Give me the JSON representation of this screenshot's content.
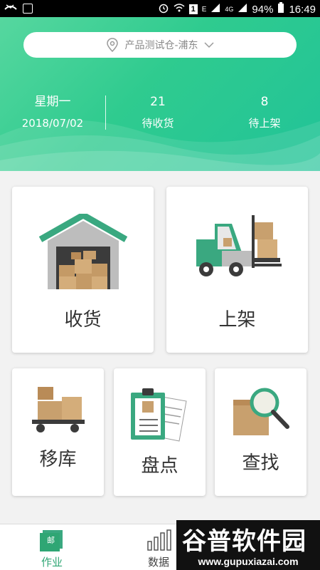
{
  "status_bar": {
    "battery": "94%",
    "time": "16:49",
    "network_e": "E",
    "network_4g": "4G"
  },
  "header": {
    "location": "产品测试仓-浦东",
    "weekday": "星期一",
    "date": "2018/07/02",
    "pending_receive_count": "21",
    "pending_receive_label": "待收货",
    "pending_shelve_count": "8",
    "pending_shelve_label": "待上架"
  },
  "menu": {
    "receive": "收货",
    "shelve": "上架",
    "move": "移库",
    "inventory": "盘点",
    "search": "查找"
  },
  "bottom_nav": {
    "work_icon_text": "邮",
    "work": "作业",
    "data": "数据"
  },
  "watermark": {
    "title": "谷普软件园",
    "url": "www.gupuxiazai.com"
  },
  "colors": {
    "accent": "#2fcb8f",
    "teal_icon": "#3aa880",
    "box_brown": "#c8a06e"
  }
}
